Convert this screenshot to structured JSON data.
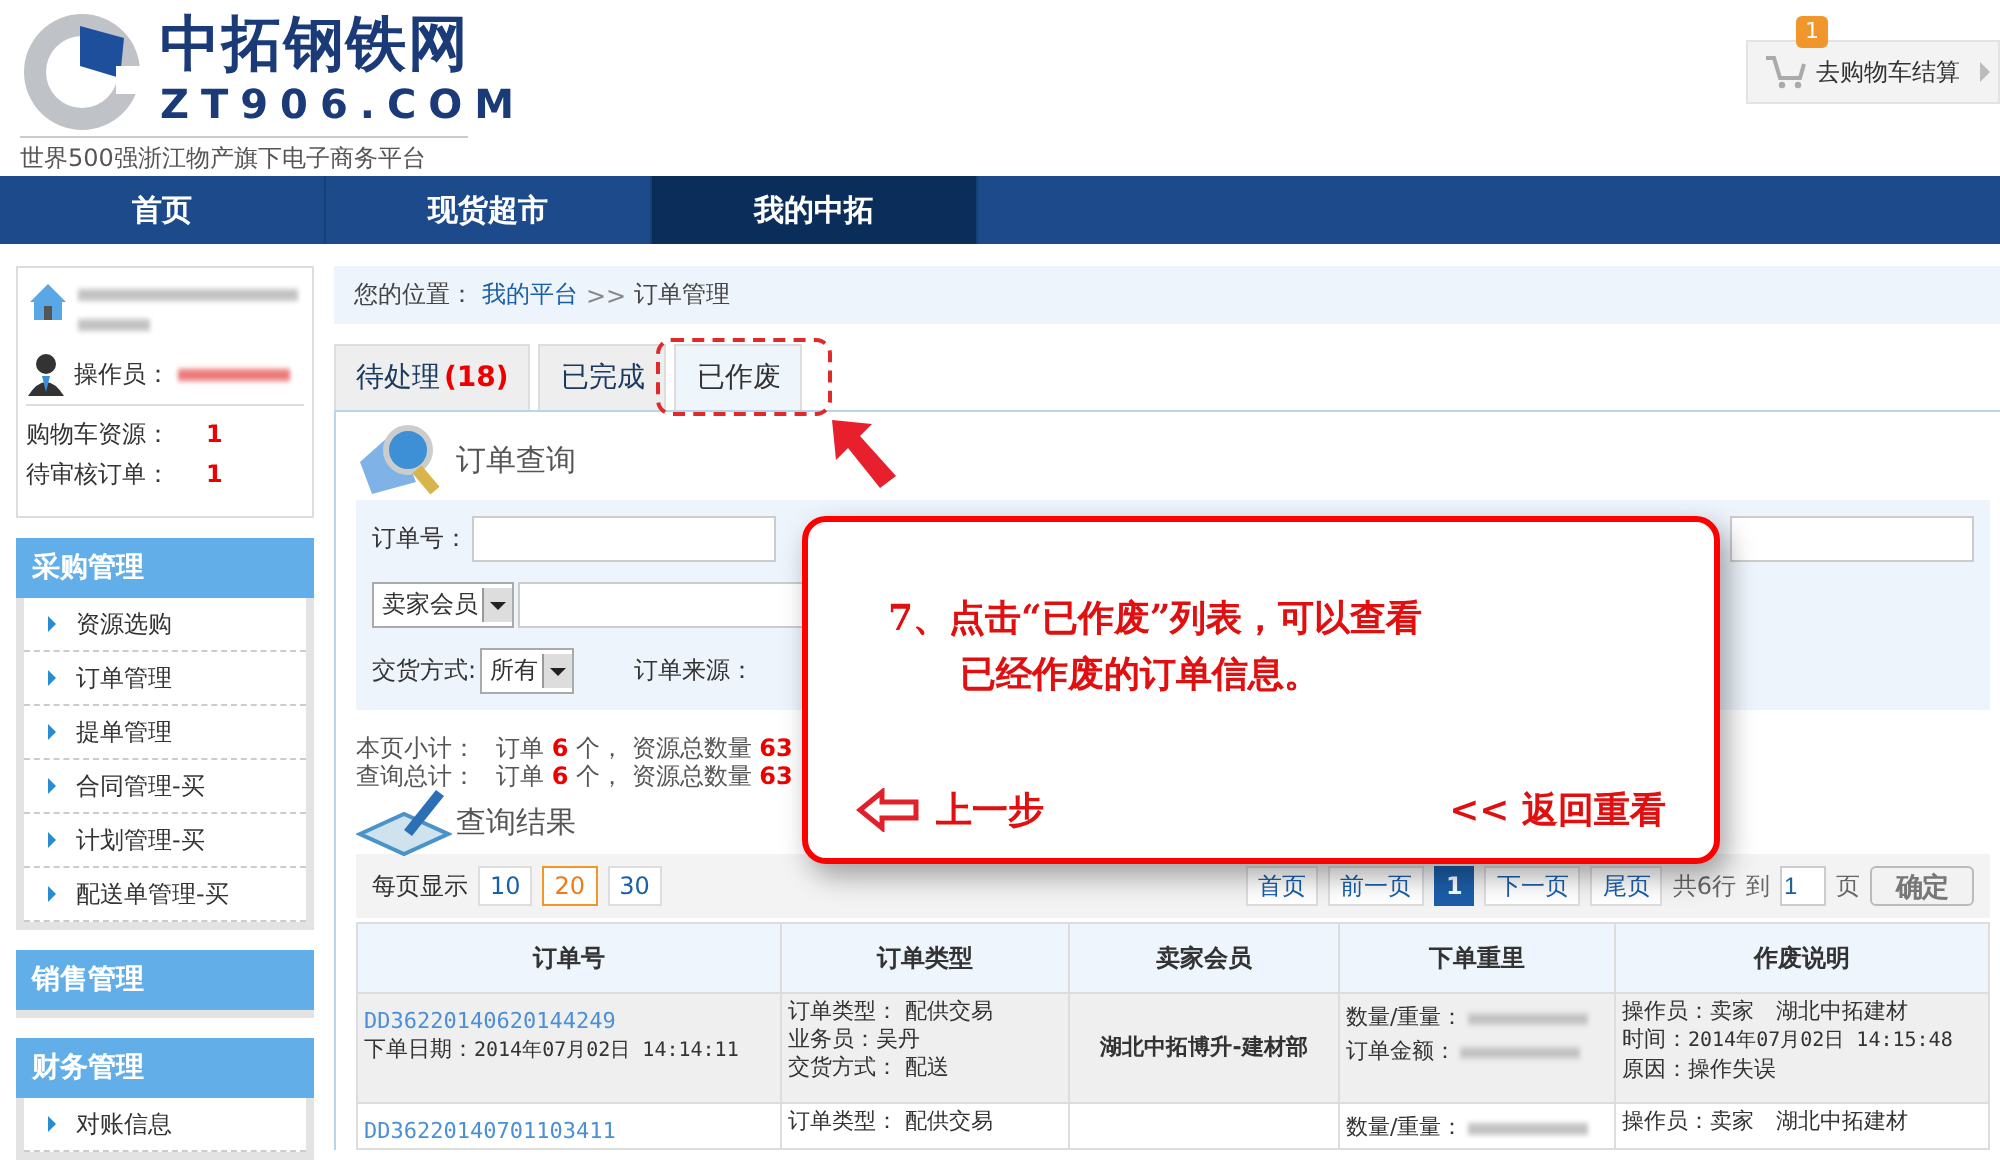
{
  "logo": {
    "title": "中拓钢铁网",
    "domain": "ZT906.COM",
    "slogan": "世界500强浙江物产旗下电子商务平台"
  },
  "cart": {
    "badge": "1",
    "label": "去购物车结算"
  },
  "nav": [
    {
      "label": "首页",
      "selected": false
    },
    {
      "label": "现货超市",
      "selected": false
    },
    {
      "label": "我的中拓",
      "selected": true
    }
  ],
  "sidebar": {
    "operator_label": "操作员：",
    "stats": [
      {
        "label": "购物车资源：",
        "value": "1"
      },
      {
        "label": "待审核订单：",
        "value": "1"
      }
    ],
    "menus": [
      {
        "title": "采购管理",
        "items": [
          "资源选购",
          "订单管理",
          "提单管理",
          "合同管理-买",
          "计划管理-买",
          "配送单管理-买"
        ]
      },
      {
        "title": "销售管理"
      },
      {
        "title": "财务管理",
        "items": [
          "对账信息"
        ]
      }
    ]
  },
  "breadcrumb": {
    "label": "您的位置：",
    "link": "我的平台",
    "separator": ">>",
    "current": "订单管理"
  },
  "tabs": [
    {
      "label": "待处理",
      "count": "(18)",
      "selected": false,
      "highlighted": false
    },
    {
      "label": "已完成",
      "selected": false,
      "highlighted": false
    },
    {
      "label": "已作废",
      "selected": true,
      "highlighted": true
    }
  ],
  "query": {
    "title": "订单查询",
    "order_no_label": "订单号：",
    "member_select": "卖家会员",
    "delivery_label": "交货方式:",
    "delivery_value": "所有",
    "source_label": "订单来源："
  },
  "summary": [
    {
      "label": "本页小计：",
      "text": "订单 **6** 个， 资源总数量 **63**"
    },
    {
      "label": "查询总计：",
      "text": "订单 **6** 个， 资源总数量 **63**"
    }
  ],
  "results": {
    "title": "查询结果",
    "page_size_label": "每页显示",
    "page_sizes": [
      {
        "label": "10",
        "selected": false
      },
      {
        "label": "20",
        "selected": true
      },
      {
        "label": "30",
        "selected": false
      }
    ],
    "pager_before": [
      "首页",
      "前一页"
    ],
    "pages": [
      {
        "label": "1",
        "selected": true
      }
    ],
    "pager_after": [
      "下一页",
      "尾页"
    ],
    "total": "共6行",
    "goto_label": "到",
    "goto_value": "1",
    "page_unit": "页",
    "confirm": "确定"
  },
  "table": {
    "columns": [
      "订单号",
      "订单类型",
      "卖家会员",
      "下单重里",
      "作废说明"
    ],
    "rows": [
      {
        "order_no": "DD36220140620144249",
        "date_label": "下单日期：",
        "date": "2014年07月02日  14:14:11",
        "type_lines": [
          "订单类型： 配供交易",
          "业务员：吴丹",
          "交货方式： 配送"
        ],
        "seller": "湖北中拓博升-建材部",
        "qty_label": "数量/重量：",
        "amount_label": "订单金额：",
        "void_lines": [
          "操作员：卖家　湖北中拓建材"
        ],
        "void_time_label": "时间：",
        "void_time": "2014年07月02日  14:15:48",
        "void_reason": "原因：操作失误"
      },
      {
        "order_no": "DD36220140701103411",
        "type_lines": [
          "订单类型： 配供交易"
        ],
        "qty_label": "数量/重量：",
        "void_lines": [
          "操作员：卖家　湖北中拓建材"
        ]
      }
    ]
  },
  "popup": {
    "lines": [
      "7、点击“已作废”列表，可以查看",
      "已经作废的订单信息。"
    ],
    "back": "上一步",
    "replay": "<< 返回重看"
  }
}
